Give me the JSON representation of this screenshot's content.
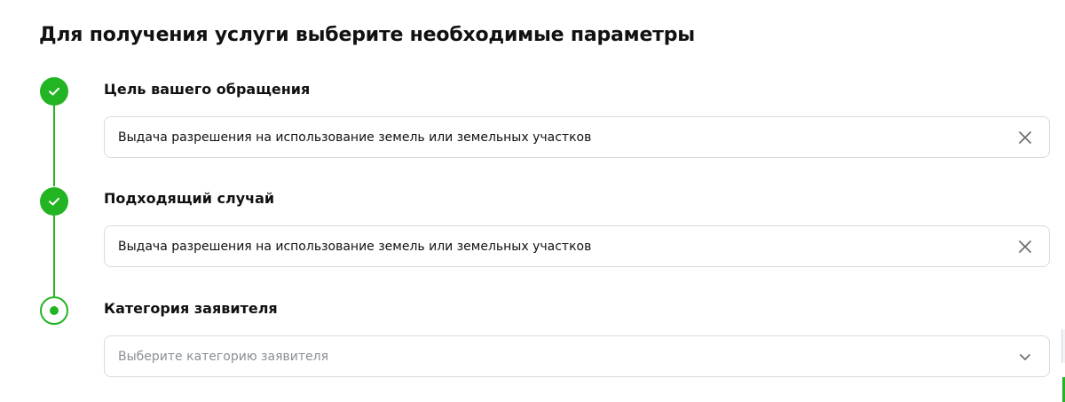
{
  "page": {
    "title": "Для получения услуги выберите необходимые параметры"
  },
  "steps": [
    {
      "label": "Цель вашего обращения",
      "status": "done",
      "value": "Выдача разрешения на использование земель или земельных участков",
      "icon": "close-icon"
    },
    {
      "label": "Подходящий случай",
      "status": "done",
      "value": "Выдача разрешения на использование земель или земельных участков",
      "icon": "close-icon"
    },
    {
      "label": "Категория заявителя",
      "status": "current",
      "placeholder": "Выберите категорию заявителя",
      "icon": "chevron-down-icon"
    }
  ],
  "colors": {
    "accent": "#22b422",
    "border": "#d6dbe1",
    "placeholder": "#8a8f96",
    "text": "#111111"
  }
}
